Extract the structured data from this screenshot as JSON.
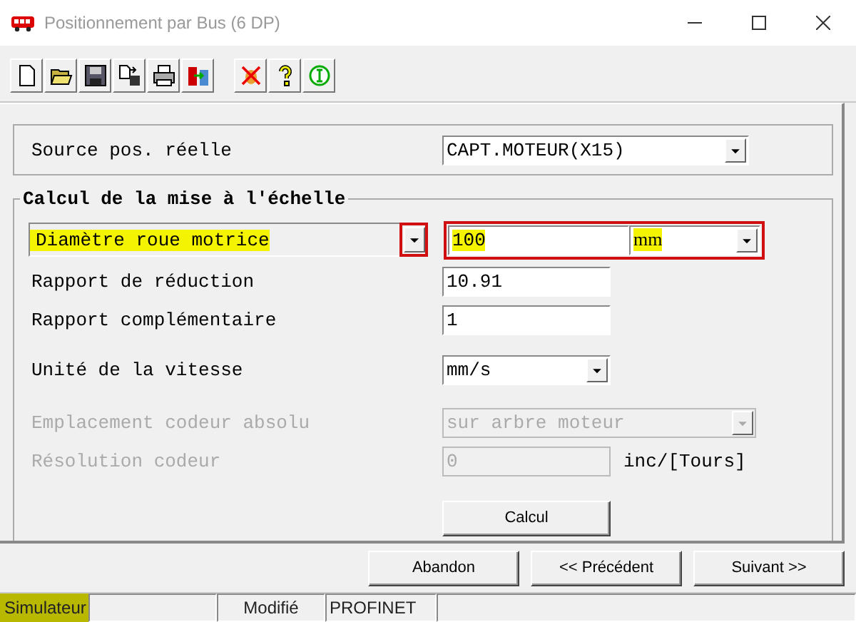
{
  "window": {
    "title": "Positionnement par Bus (6 DP)"
  },
  "toolbar": [
    {
      "kind": "new"
    },
    {
      "kind": "open"
    },
    {
      "kind": "save"
    },
    {
      "kind": "export"
    },
    {
      "kind": "print"
    },
    {
      "kind": "transfer"
    },
    {
      "kind": "debug"
    },
    {
      "kind": "help"
    },
    {
      "kind": "info"
    }
  ],
  "source": {
    "label": "Source pos. réelle",
    "value": "CAPT.MOTEUR(X15)"
  },
  "group": {
    "title": "Calcul de la mise à l'échelle",
    "rows": [
      {
        "kind": "combo-field",
        "label": "Diamètre roue motrice",
        "highlighted": true,
        "annotated": true,
        "value": "100",
        "unit": "mm",
        "disabled": false
      },
      {
        "kind": "field",
        "label": "Rapport de réduction",
        "highlighted": false,
        "value": "10.91",
        "disabled": false
      },
      {
        "kind": "field",
        "label": "Rapport complémentaire",
        "highlighted": false,
        "value": "1",
        "disabled": false
      },
      {
        "kind": "select",
        "label": "Unité de la vitesse",
        "highlighted": false,
        "value": "mm/s",
        "disabled": false
      },
      {
        "kind": "wide-select",
        "label": "Emplacement codeur absolu",
        "highlighted": false,
        "value": "sur arbre moteur",
        "disabled": true
      },
      {
        "kind": "field-suffix",
        "label": "Résolution codeur",
        "highlighted": false,
        "value": "0",
        "suffix": "inc/[Tours]",
        "disabled": true
      }
    ],
    "button": "Calcul"
  },
  "buttons": [
    "Abandon",
    "<< Précédent",
    "Suivant >>"
  ],
  "status_bar": [
    {
      "text": "Simulateur",
      "highlighted": true
    },
    {
      "highlighted": false
    },
    {
      "text": "Modifié",
      "highlighted": false
    },
    {
      "text": "PROFINET",
      "highlighted": false
    },
    {
      "highlighted": false
    }
  ]
}
